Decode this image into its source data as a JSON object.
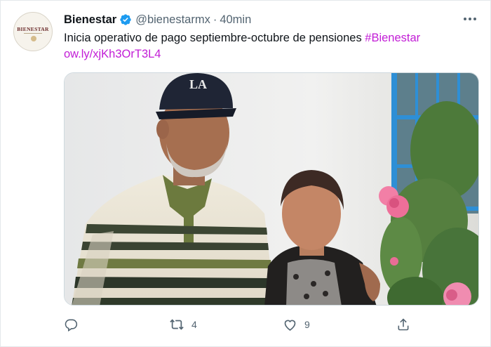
{
  "tweet": {
    "avatar_logo_text": "BIENESTAR",
    "display_name": "Bienestar",
    "handle": "@bienestarmx",
    "separator": "·",
    "time": "40min",
    "text_plain": "Inicia operativo de pago septiembre-octubre de pensiones ",
    "hashtag": "#Bienestar",
    "link": "ow.ly/xjKh3OrT3L4",
    "image_alt": "Older couple smiling in front of a white wall with pink roses",
    "actions": {
      "reply_icon": "reply-icon",
      "retweet_icon": "retweet-icon",
      "retweet_count": "4",
      "like_icon": "heart-icon",
      "like_count": "9",
      "share_icon": "share-icon"
    },
    "colors": {
      "link": "#c21dd6",
      "verified": "#1d9bf0",
      "secondary_text": "#536471"
    }
  }
}
